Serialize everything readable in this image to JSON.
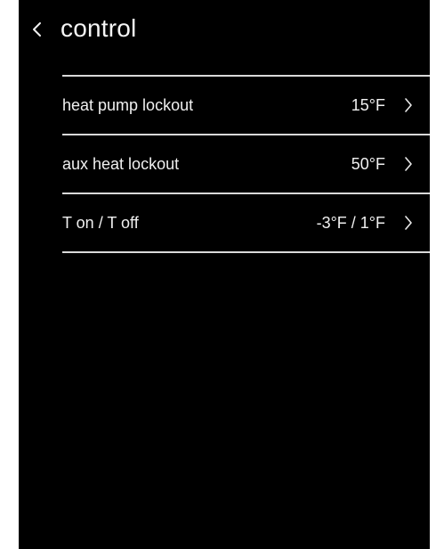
{
  "header": {
    "title": "control",
    "back_icon": "chevron-left-icon"
  },
  "settings": [
    {
      "label": "heat pump lockout",
      "value": "15°F",
      "icon": "chevron-right-icon"
    },
    {
      "label": "aux heat lockout",
      "value": "50°F",
      "icon": "chevron-right-icon"
    },
    {
      "label": "T on / T off",
      "value": "-3°F / 1°F",
      "icon": "chevron-right-icon"
    }
  ],
  "colors": {
    "background": "#000000",
    "text": "#f0f0f0",
    "divider": "#d9d9d9",
    "frame": "#ffffff"
  }
}
